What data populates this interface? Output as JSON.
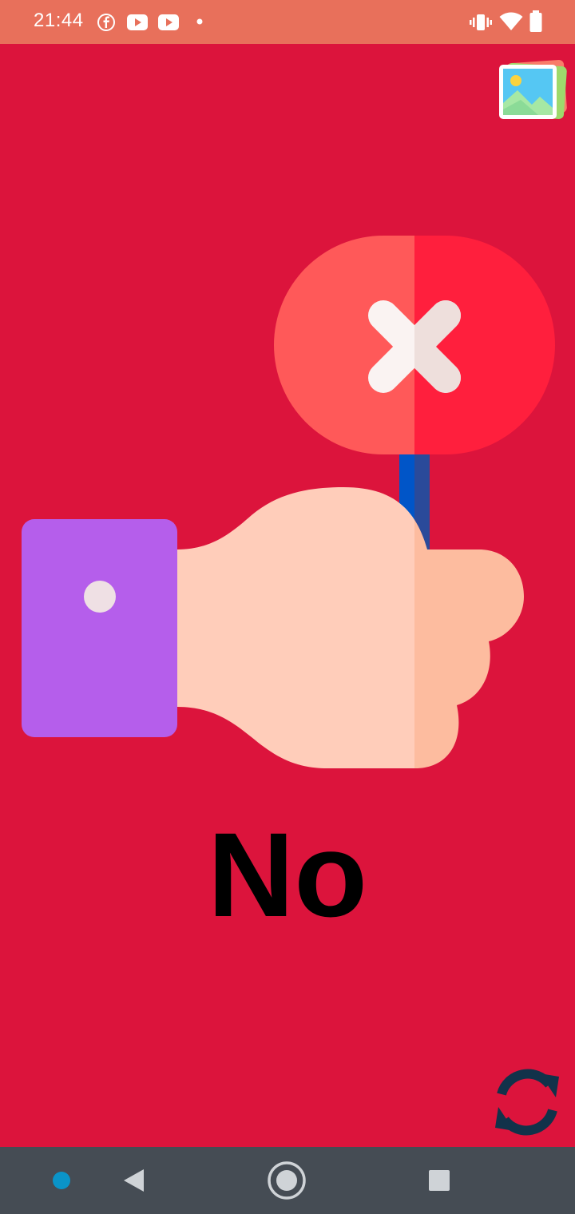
{
  "status_bar": {
    "time": "21:44",
    "notification_icons": [
      "facebook-icon",
      "youtube-icon",
      "youtube-icon",
      "dot-icon"
    ],
    "system_icons": [
      "vibrate-icon",
      "wifi-icon",
      "battery-icon"
    ],
    "background_color": "#E8705B"
  },
  "main": {
    "background_color": "#DC143C",
    "word": "No",
    "illustration": "hand-holding-no-sign",
    "gallery_icon": "image-gallery-icon",
    "refresh_icon": "refresh-icon"
  },
  "nav_bar": {
    "buttons": [
      "back-icon",
      "home-icon",
      "recents-icon"
    ],
    "indicator": "dot-indicator",
    "background_color": "#454C54"
  }
}
